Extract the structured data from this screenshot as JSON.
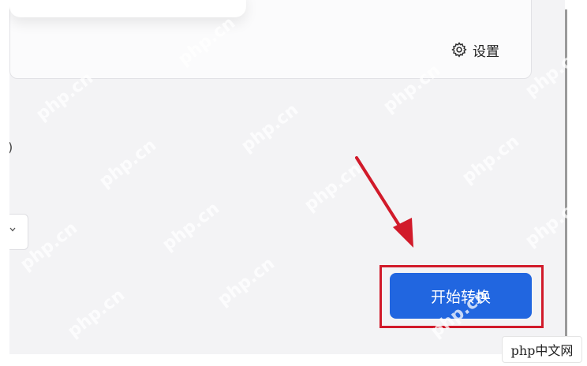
{
  "settings": {
    "label": "设置",
    "icon": "gear-icon"
  },
  "partial_text": ")",
  "dropdown": {
    "icon": "chevron-down-icon"
  },
  "primary_action": {
    "label": "开始转换",
    "color": "#2166e0"
  },
  "annotation": {
    "highlight_color": "#d11a2a",
    "arrow_color": "#d11a2a"
  },
  "watermark": {
    "text": "php.cn",
    "logo": "php中文网"
  }
}
